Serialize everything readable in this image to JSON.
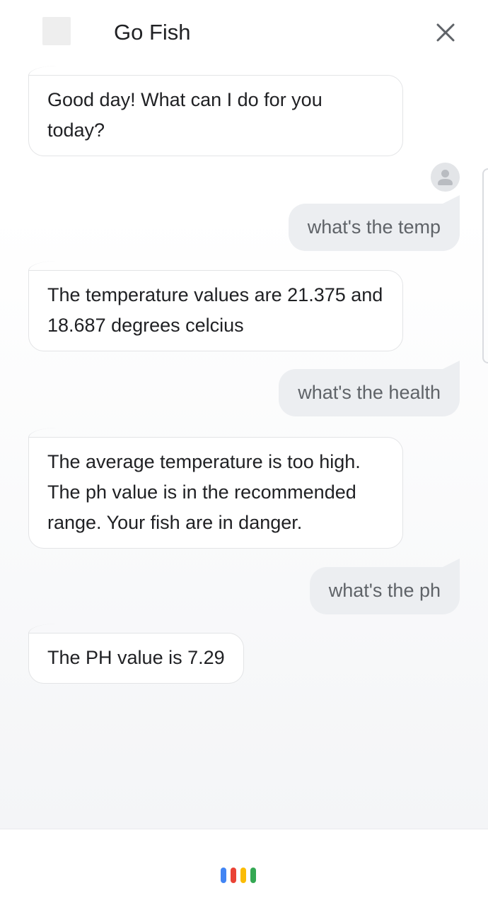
{
  "header": {
    "title": "Go Fish"
  },
  "conversation": {
    "messages": [
      {
        "role": "bot",
        "text": "Good day! What can I do for you today?"
      },
      {
        "role": "user",
        "text": "what's the temp"
      },
      {
        "role": "bot",
        "text": "The temperature values are 21.375 and 18.687 degrees celcius"
      },
      {
        "role": "user",
        "text": "what's the health"
      },
      {
        "role": "bot",
        "text": "The average temperature is too high. The ph value is in the recommended range. Your fish are in danger."
      },
      {
        "role": "user",
        "text": "what's the ph"
      },
      {
        "role": "bot",
        "text": "The PH value is 7.29"
      }
    ]
  },
  "icons": {
    "close": "close-icon",
    "avatar": "user-avatar-icon",
    "mic": "assistant-mic-icon"
  },
  "colors": {
    "blue": "#4285f4",
    "red": "#ea4335",
    "yellow": "#fbbc05",
    "green": "#34a853",
    "user_bubble": "#eceef1",
    "user_text": "#5f6368",
    "bot_text": "#202124"
  }
}
